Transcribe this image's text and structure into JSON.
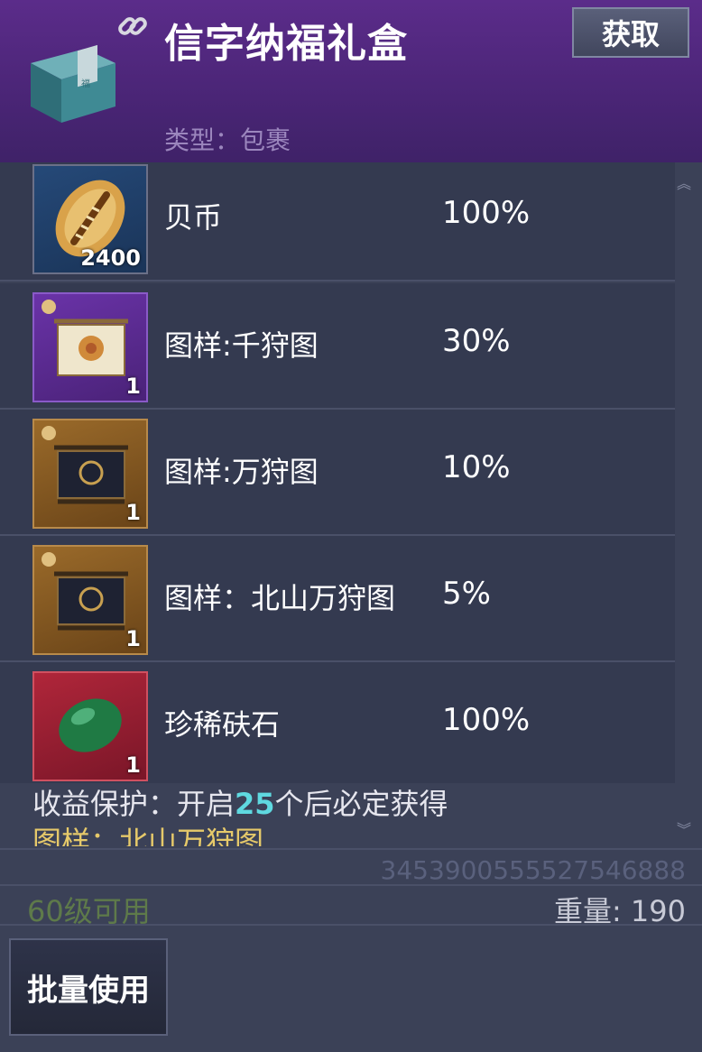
{
  "header": {
    "title": "信字纳福礼盒",
    "get_button": "获取",
    "type_line": "类型：包裹"
  },
  "items": [
    {
      "name": "贝币",
      "chance": "100%",
      "qty": "2400",
      "icon": "cowrie-shell-icon",
      "rarity_color": "#254978"
    },
    {
      "name": "图样:千狩图",
      "chance": "30%",
      "qty": "1",
      "icon": "scroll-painting-icon",
      "rarity_color": "#6a33a8"
    },
    {
      "name": "图样:万狩图",
      "chance": "10%",
      "qty": "1",
      "icon": "scroll-painting-icon",
      "rarity_color": "#9a6a2a"
    },
    {
      "name": "图样：北山万狩图",
      "chance": "5%",
      "qty": "1",
      "icon": "scroll-painting-icon",
      "rarity_color": "#9a6a2a"
    },
    {
      "name": "珍稀砆石",
      "chance": "100%",
      "qty": "1",
      "icon": "green-gem-icon",
      "rarity_color": "#b0263a"
    }
  ],
  "protection": {
    "prefix": "收益保护：开启",
    "count": "25",
    "suffix": "个后必定获得",
    "target": "图样：北山万狩图"
  },
  "serial": "3453900555527546888",
  "level_text": "60级可用",
  "weight_text": "重量: 190",
  "batch_button": "批量使用"
}
